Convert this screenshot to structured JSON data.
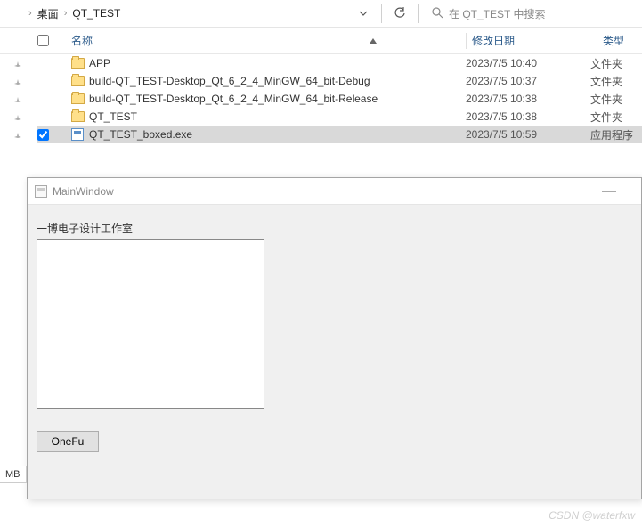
{
  "breadcrumb": {
    "sep1": "›",
    "parent": "桌面",
    "sep2": "›",
    "current": "QT_TEST"
  },
  "search": {
    "placeholder": "在 QT_TEST 中搜索"
  },
  "headers": {
    "name": "名称",
    "date": "修改日期",
    "type": "类型"
  },
  "rows": [
    {
      "name": "APP",
      "date": "2023/7/5 10:40",
      "type": "文件夹",
      "kind": "folder"
    },
    {
      "name": "build-QT_TEST-Desktop_Qt_6_2_4_MinGW_64_bit-Debug",
      "date": "2023/7/5 10:37",
      "type": "文件夹",
      "kind": "folder"
    },
    {
      "name": "build-QT_TEST-Desktop_Qt_6_2_4_MinGW_64_bit-Release",
      "date": "2023/7/5 10:38",
      "type": "文件夹",
      "kind": "folder"
    },
    {
      "name": "QT_TEST",
      "date": "2023/7/5 10:38",
      "type": "文件夹",
      "kind": "folder"
    },
    {
      "name": "QT_TEST_boxed.exe",
      "date": "2023/7/5 10:59",
      "type": "应用程序",
      "kind": "exe",
      "selected": true,
      "checked": true
    }
  ],
  "dialog": {
    "title": "MainWindow",
    "group_label": "一博电子设计工作室",
    "button": "OneFu"
  },
  "mb_label": "MB",
  "watermark": "CSDN @waterfxw"
}
